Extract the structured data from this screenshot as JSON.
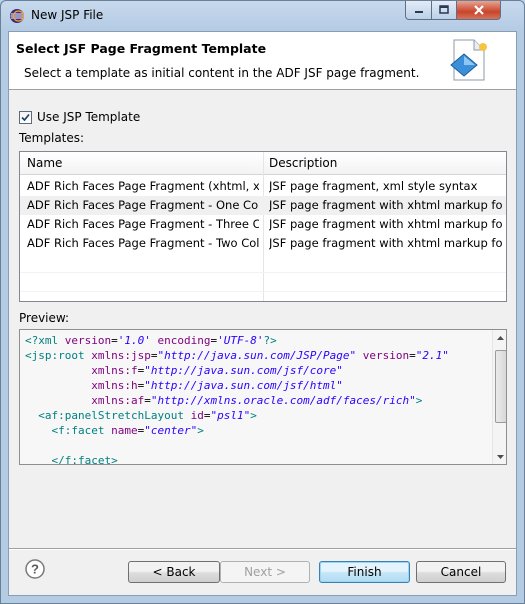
{
  "window": {
    "title": "New JSP File",
    "controls": [
      "minimize-icon",
      "maximize-icon",
      "close-icon"
    ]
  },
  "banner": {
    "title": "Select JSF Page Fragment Template",
    "description": "Select a template as initial content in the ADF JSF page fragment.",
    "icon": "jsp-file-wizard-icon"
  },
  "options": {
    "use_template_label": "Use JSP Template",
    "use_template_checked": true,
    "templates_label": "Templates:"
  },
  "templates_table": {
    "columns": [
      "Name",
      "Description"
    ],
    "rows": [
      {
        "name": "ADF Rich Faces Page Fragment (xhtml, xm...",
        "description": "JSF page fragment, xml style syntax",
        "selected": false
      },
      {
        "name": "ADF Rich Faces Page Fragment - One Col...",
        "description": "JSF page fragment with xhtml markup for...",
        "selected": true
      },
      {
        "name": "ADF Rich Faces Page Fragment - Three Co...",
        "description": "JSF page fragment with xhtml markup for...",
        "selected": false
      },
      {
        "name": "ADF Rich Faces Page Fragment - Two Col...",
        "description": "JSF page fragment with xhtml markup for...",
        "selected": false
      }
    ]
  },
  "preview": {
    "label": "Preview:",
    "lines": [
      [
        {
          "t": "pi",
          "v": "<?xml "
        },
        {
          "t": "attr",
          "v": "version"
        },
        {
          "t": "plain",
          "v": "="
        },
        {
          "t": "val",
          "v": "'1.0'"
        },
        {
          "t": "plain",
          "v": " "
        },
        {
          "t": "attr",
          "v": "encoding"
        },
        {
          "t": "plain",
          "v": "="
        },
        {
          "t": "val",
          "v": "'UTF-8'"
        },
        {
          "t": "pi",
          "v": "?>"
        }
      ],
      [
        {
          "t": "tag",
          "v": "<jsp:root "
        },
        {
          "t": "attr",
          "v": "xmlns:jsp"
        },
        {
          "t": "plain",
          "v": "="
        },
        {
          "t": "val",
          "v": "\"http://java.sun.com/JSP/Page\""
        },
        {
          "t": "plain",
          "v": " "
        },
        {
          "t": "attr",
          "v": "version"
        },
        {
          "t": "plain",
          "v": "="
        },
        {
          "t": "val",
          "v": "\"2.1\""
        }
      ],
      [
        {
          "t": "plain",
          "v": "          "
        },
        {
          "t": "attr",
          "v": "xmlns:f"
        },
        {
          "t": "plain",
          "v": "="
        },
        {
          "t": "val",
          "v": "\"http://java.sun.com/jsf/core\""
        }
      ],
      [
        {
          "t": "plain",
          "v": "          "
        },
        {
          "t": "attr",
          "v": "xmlns:h"
        },
        {
          "t": "plain",
          "v": "="
        },
        {
          "t": "val",
          "v": "\"http://java.sun.com/jsf/html\""
        }
      ],
      [
        {
          "t": "plain",
          "v": "          "
        },
        {
          "t": "attr",
          "v": "xmlns:af"
        },
        {
          "t": "plain",
          "v": "="
        },
        {
          "t": "val",
          "v": "\"http://xmlns.oracle.com/adf/faces/rich\""
        },
        {
          "t": "tag",
          "v": ">"
        }
      ],
      [
        {
          "t": "plain",
          "v": "  "
        },
        {
          "t": "tag",
          "v": "<af:panelStretchLayout "
        },
        {
          "t": "attr",
          "v": "id"
        },
        {
          "t": "plain",
          "v": "="
        },
        {
          "t": "val",
          "v": "\"psl1\""
        },
        {
          "t": "tag",
          "v": ">"
        }
      ],
      [
        {
          "t": "plain",
          "v": "    "
        },
        {
          "t": "tag",
          "v": "<f:facet "
        },
        {
          "t": "attr",
          "v": "name"
        },
        {
          "t": "plain",
          "v": "="
        },
        {
          "t": "val",
          "v": "\"center\""
        },
        {
          "t": "tag",
          "v": ">"
        }
      ],
      [
        {
          "t": "plain",
          "v": ""
        }
      ],
      [
        {
          "t": "plain",
          "v": "    "
        },
        {
          "t": "tag",
          "v": "</f:facet>"
        }
      ]
    ]
  },
  "buttons": {
    "help_icon": "help-icon",
    "back": "< Back",
    "next": "Next >",
    "finish": "Finish",
    "cancel": "Cancel"
  }
}
